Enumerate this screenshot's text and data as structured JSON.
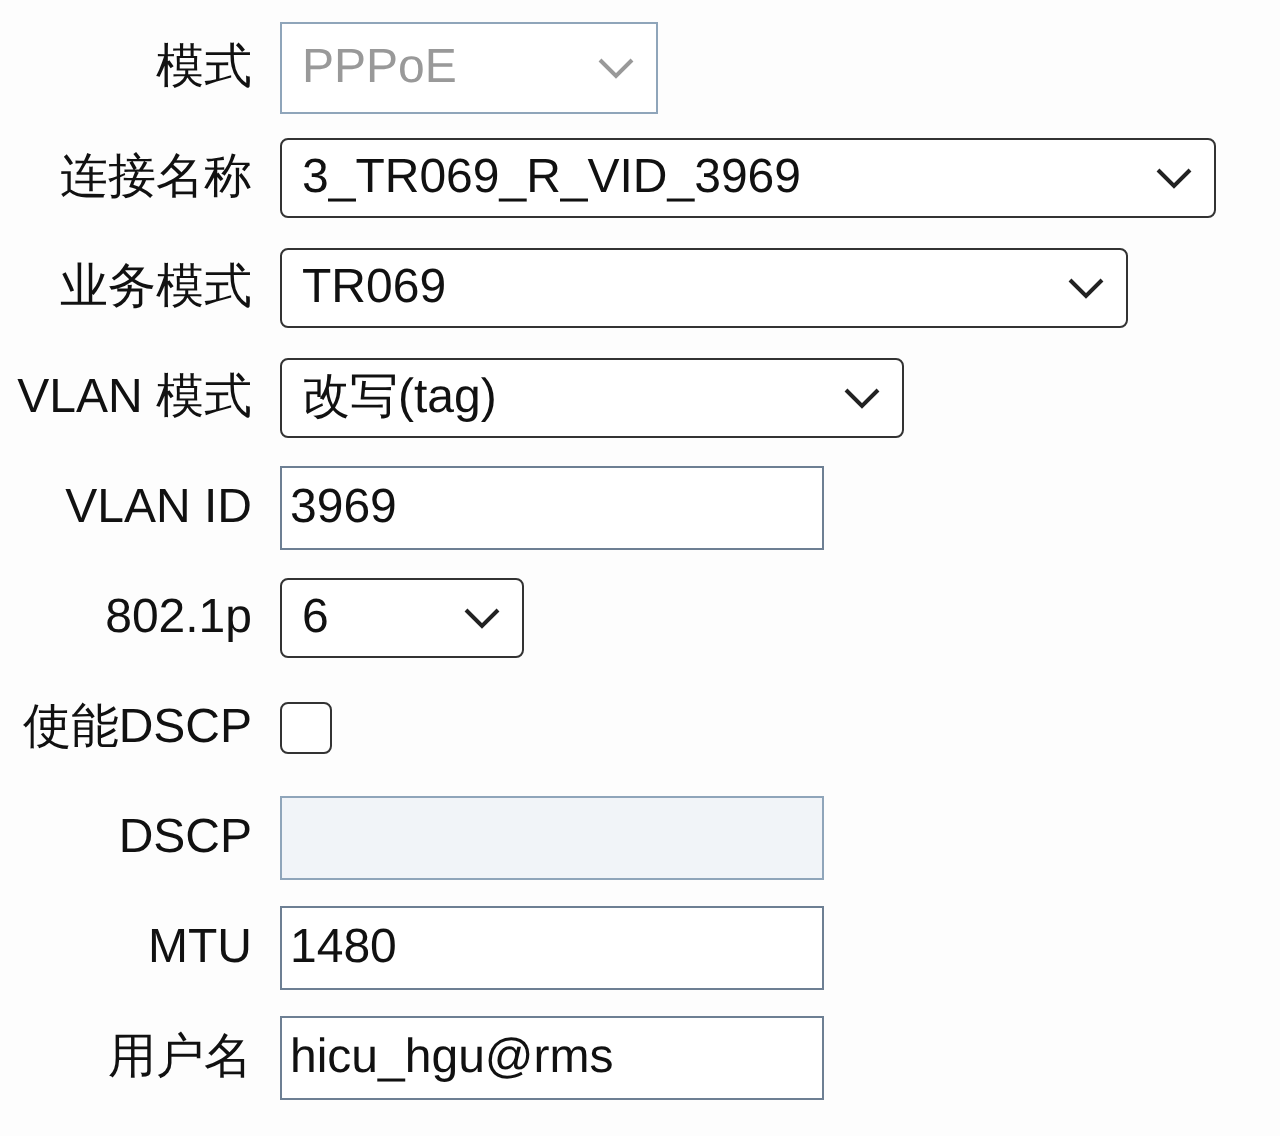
{
  "fields": [
    {
      "label": "模式",
      "kind": "select",
      "value": "PPPoE",
      "disabled": true
    },
    {
      "label": "连接名称",
      "kind": "select",
      "value": "3_TR069_R_VID_3969",
      "disabled": false
    },
    {
      "label": "业务模式",
      "kind": "select",
      "value": "TR069",
      "disabled": false
    },
    {
      "label": "VLAN 模式",
      "kind": "select",
      "value": "改写(tag)",
      "disabled": false
    },
    {
      "label": "VLAN ID",
      "kind": "input",
      "value": "3969",
      "disabled": false
    },
    {
      "label": "802.1p",
      "kind": "select",
      "value": "6",
      "disabled": false
    },
    {
      "label": "使能DSCP",
      "kind": "checkbox",
      "checked": false
    },
    {
      "label": "DSCP",
      "kind": "input",
      "disabled": true
    },
    {
      "label": "MTU",
      "kind": "input",
      "value": "1480",
      "disabled": false
    },
    {
      "label": "用户名",
      "kind": "input",
      "value": "hicu_hgu@rms",
      "disabled": false
    }
  ]
}
